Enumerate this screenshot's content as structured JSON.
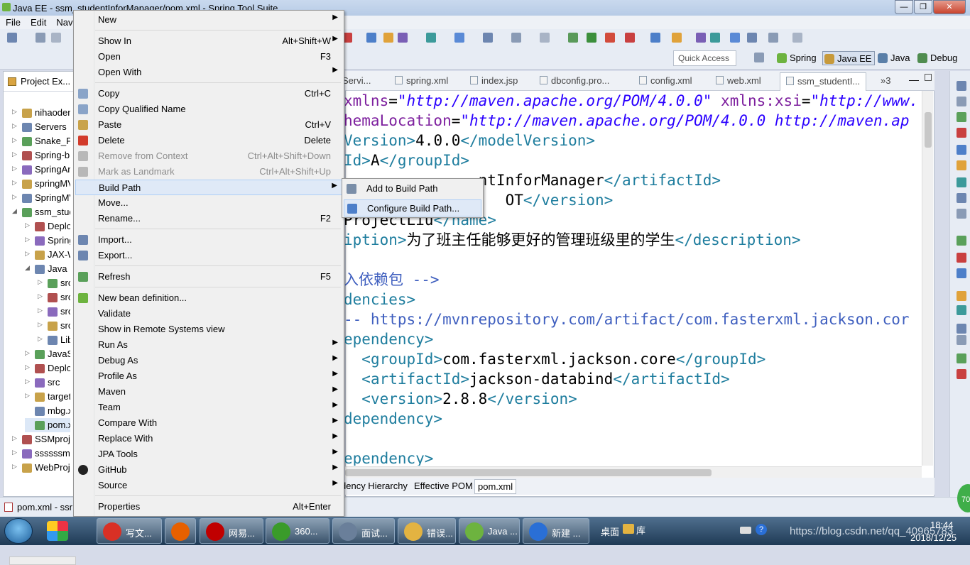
{
  "window": {
    "title": "Java EE - ssm_studentInforManager/pom.xml - Spring Tool Suite"
  },
  "menubar": [
    "File",
    "Edit",
    "Navi"
  ],
  "toolbar": {
    "quick_access": "Quick Access",
    "perspectives": [
      "Spring",
      "Java EE",
      "Java",
      "Debug"
    ]
  },
  "explorer": {
    "title": "Project Ex...",
    "items": [
      {
        "label": "nihaoden",
        "level": 0,
        "expander": "▷"
      },
      {
        "label": "Servers",
        "level": 0,
        "expander": "▷"
      },
      {
        "label": "Snake_Pr",
        "level": 0,
        "expander": "▷"
      },
      {
        "label": "Spring-b",
        "level": 0,
        "expander": "▷"
      },
      {
        "label": "SpringAn",
        "level": 0,
        "expander": "▷"
      },
      {
        "label": "springMV",
        "level": 0,
        "expander": "▷"
      },
      {
        "label": "SpringMV",
        "level": 0,
        "expander": "▷"
      },
      {
        "label": "ssm_stud",
        "level": 0,
        "expander": "◢"
      },
      {
        "label": "Deplo",
        "level": 1,
        "expander": "▷"
      },
      {
        "label": "Spring",
        "level": 1,
        "expander": "▷"
      },
      {
        "label": "JAX-W",
        "level": 1,
        "expander": "▷"
      },
      {
        "label": "Java R",
        "level": 1,
        "expander": "◢"
      },
      {
        "label": "src",
        "level": 2,
        "expander": "▷"
      },
      {
        "label": "src",
        "level": 2,
        "expander": "▷"
      },
      {
        "label": "src",
        "level": 2,
        "expander": "▷"
      },
      {
        "label": "src",
        "level": 2,
        "expander": "▷"
      },
      {
        "label": "Lib",
        "level": 2,
        "expander": "▷"
      },
      {
        "label": "JavaSc",
        "level": 1,
        "expander": "▷"
      },
      {
        "label": "Deplo",
        "level": 1,
        "expander": "▷"
      },
      {
        "label": "src",
        "level": 1,
        "expander": "▷"
      },
      {
        "label": "target",
        "level": 1,
        "expander": "▷"
      },
      {
        "label": "mbg.x",
        "level": 1,
        "expander": ""
      },
      {
        "label": "pom.x",
        "level": 1,
        "expander": ""
      },
      {
        "label": "SSMproje",
        "level": 0,
        "expander": "▷"
      },
      {
        "label": "ssssssmm",
        "level": 0,
        "expander": "▷"
      },
      {
        "label": "WebProje",
        "level": 0,
        "expander": "▷"
      }
    ]
  },
  "editor_tabs": [
    "Servi...",
    "spring.xml",
    "index.jsp",
    "dbconfig.pro...",
    "config.xml",
    "web.xml",
    "ssm_studentI...",
    "»3"
  ],
  "code_lines": [
    [
      [
        "at",
        "xmlns"
      ],
      [
        "",
        "="
      ],
      [
        "val",
        "\"http://maven.apache.org/POM/4.0.0\""
      ],
      [
        "",
        " "
      ],
      [
        "at",
        "xmlns:xsi"
      ],
      [
        "",
        "="
      ],
      [
        "val",
        "\"http://www."
      ]
    ],
    [
      [
        "at",
        "hemaLocation"
      ],
      [
        "",
        "="
      ],
      [
        "val",
        "\"http://maven.apache.org/POM/4.0.0 http://maven.ap"
      ]
    ],
    [
      [
        "tag",
        "Version>"
      ],
      [
        "",
        "4.0.0"
      ],
      [
        "tag",
        "</modelVersion>"
      ]
    ],
    [
      [
        "tag",
        "Id>"
      ],
      [
        "",
        "A"
      ],
      [
        "tag",
        "</groupId>"
      ]
    ],
    [
      [
        "tag",
        "     "
      ],
      [
        "",
        "          ntInforManager"
      ],
      [
        "tag",
        "</artifactId>"
      ]
    ],
    [
      [
        "",
        "                  OT"
      ],
      [
        "tag",
        "</version>"
      ]
    ],
    [
      [
        "",
        "ProjectLiu"
      ],
      [
        "tag",
        "</name>"
      ]
    ],
    [
      [
        "tag",
        "iption>"
      ],
      [
        "",
        "为了班主任能够更好的管理班级里的学生"
      ],
      [
        "tag",
        "</description>"
      ]
    ],
    [
      [
        "",
        ""
      ]
    ],
    [
      [
        "cm",
        "入依赖包 -->"
      ]
    ],
    [
      [
        "tag",
        "dencies>"
      ]
    ],
    [
      [
        "cm",
        "-- https://mvnrepository.com/artifact/com.fasterxml.jackson.cor"
      ]
    ],
    [
      [
        "tag",
        "ependency>"
      ]
    ],
    [
      [
        "",
        "  "
      ],
      [
        "tag",
        "<groupId>"
      ],
      [
        "",
        "com.fasterxml.jackson.core"
      ],
      [
        "tag",
        "</groupId>"
      ]
    ],
    [
      [
        "",
        "  "
      ],
      [
        "tag",
        "<artifactId>"
      ],
      [
        "",
        "jackson-databind"
      ],
      [
        "tag",
        "</artifactId>"
      ]
    ],
    [
      [
        "",
        "  "
      ],
      [
        "tag",
        "<version>"
      ],
      [
        "",
        "2.8.8"
      ],
      [
        "tag",
        "</version>"
      ]
    ],
    [
      [
        "tag",
        "dependency>"
      ]
    ],
    [
      [
        "",
        ""
      ]
    ],
    [
      [
        "tag",
        "ependency>"
      ]
    ]
  ],
  "bottom_tabs": [
    "dency Hierarchy",
    "Effective POM",
    "pom.xml"
  ],
  "status": {
    "text": "pom.xml - ssr"
  },
  "context_menu": [
    {
      "label": "New",
      "shortcut": "",
      "sub": true
    },
    {
      "sep": true
    },
    {
      "label": "Show In",
      "shortcut": "Alt+Shift+W",
      "sub": true
    },
    {
      "label": "Open",
      "shortcut": "F3"
    },
    {
      "label": "Open With",
      "shortcut": "",
      "sub": true
    },
    {
      "sep": true
    },
    {
      "label": "Copy",
      "shortcut": "Ctrl+C",
      "icon": "copy-icon"
    },
    {
      "label": "Copy Qualified Name",
      "shortcut": "",
      "icon": "copy-icon"
    },
    {
      "label": "Paste",
      "shortcut": "Ctrl+V",
      "icon": "paste-icon"
    },
    {
      "label": "Delete",
      "shortcut": "Delete",
      "icon": "delete-icon"
    },
    {
      "label": "Remove from Context",
      "shortcut": "Ctrl+Alt+Shift+Down",
      "disabled": true,
      "icon": "remove-context-icon"
    },
    {
      "label": "Mark as Landmark",
      "shortcut": "Ctrl+Alt+Shift+Up",
      "disabled": true,
      "icon": "landmark-icon"
    },
    {
      "label": "Build Path",
      "shortcut": "",
      "sub": true,
      "highlight": true
    },
    {
      "label": "Move...",
      "shortcut": ""
    },
    {
      "label": "Rename...",
      "shortcut": "F2"
    },
    {
      "sep": true
    },
    {
      "label": "Import...",
      "shortcut": "",
      "icon": "import-icon"
    },
    {
      "label": "Export...",
      "shortcut": "",
      "icon": "export-icon"
    },
    {
      "sep": true
    },
    {
      "label": "Refresh",
      "shortcut": "F5",
      "icon": "refresh-icon"
    },
    {
      "sep": true
    },
    {
      "label": "New bean definition...",
      "shortcut": "",
      "icon": "bean-icon"
    },
    {
      "label": "Validate",
      "shortcut": ""
    },
    {
      "label": "Show in Remote Systems view",
      "shortcut": ""
    },
    {
      "label": "Run As",
      "shortcut": "",
      "sub": true
    },
    {
      "label": "Debug As",
      "shortcut": "",
      "sub": true
    },
    {
      "label": "Profile As",
      "shortcut": "",
      "sub": true
    },
    {
      "label": "Maven",
      "shortcut": "",
      "sub": true
    },
    {
      "label": "Team",
      "shortcut": "",
      "sub": true
    },
    {
      "label": "Compare With",
      "shortcut": "",
      "sub": true
    },
    {
      "label": "Replace With",
      "shortcut": "",
      "sub": true
    },
    {
      "label": "JPA Tools",
      "shortcut": "",
      "sub": true
    },
    {
      "label": "GitHub",
      "shortcut": "",
      "sub": true,
      "icon": "github-icon"
    },
    {
      "label": "Source",
      "shortcut": "",
      "sub": true
    },
    {
      "sep": true
    },
    {
      "label": "Properties",
      "shortcut": "Alt+Enter"
    }
  ],
  "submenu": [
    {
      "label": "Add to Build Path",
      "icon": "add-build-path-icon"
    },
    {
      "label": "Configure Build Path...",
      "icon": "configure-build-path-icon",
      "highlight": true
    }
  ],
  "taskbar": {
    "items": [
      {
        "label": "写文...",
        "color": "#d93025"
      },
      {
        "label": "",
        "color": "#e66000"
      },
      {
        "label": "网易...",
        "color": "#c00000"
      },
      {
        "label": "360...",
        "color": "#3a9b2a"
      },
      {
        "label": "面试...",
        "color": "#6a7f9a"
      },
      {
        "label": "错误...",
        "color": "#e3b341"
      },
      {
        "label": "Java ...",
        "color": "#6db33f"
      },
      {
        "label": "新建 ...",
        "color": "#2a6fd6"
      }
    ],
    "desktop_label": "桌面",
    "library_label": "库",
    "time": "18:44",
    "date": "2018/12/25",
    "watermark": "https://blog.csdn.net/qq_40965783"
  },
  "badge": "70"
}
